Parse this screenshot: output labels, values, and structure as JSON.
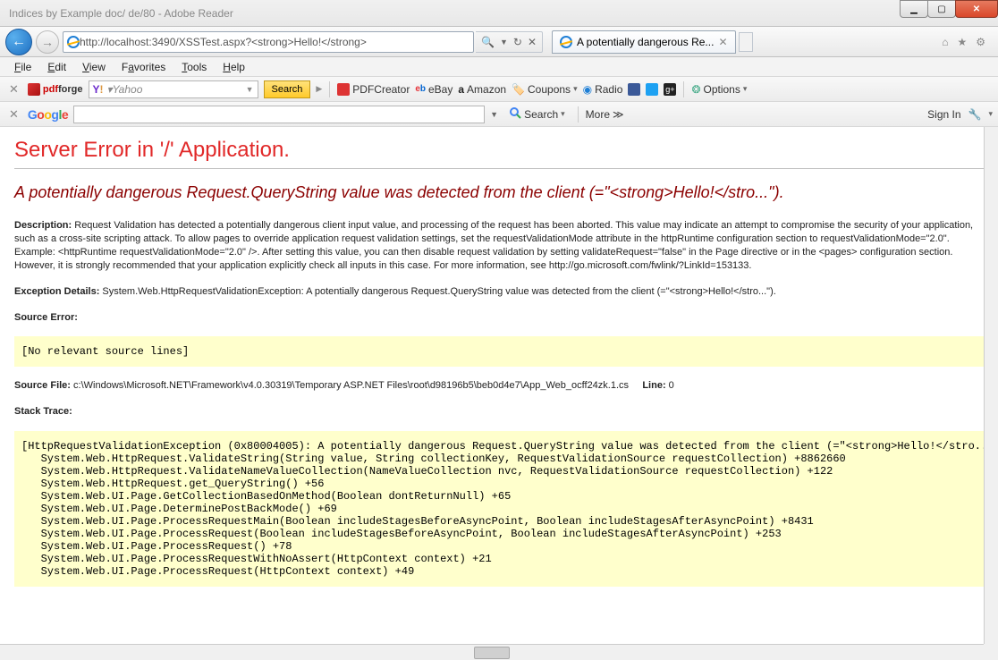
{
  "window": {
    "background_title": "Indices by Example doc/ de/80 - Adobe Reader"
  },
  "nav": {
    "url": "http://localhost:3490/XSSTest.aspx?<strong>Hello!</strong>",
    "tab_title": "A potentially dangerous Re..."
  },
  "menu": {
    "file": "File",
    "edit": "Edit",
    "view": "View",
    "favorites": "Favorites",
    "tools": "Tools",
    "help": "Help"
  },
  "toolbar1": {
    "pdfforge": "pdfforge",
    "yahoo_placeholder": "Yahoo",
    "search_btn": "Search",
    "pdfcreator": "PDFCreator",
    "ebay": "eBay",
    "amazon": "Amazon",
    "coupons": "Coupons",
    "radio": "Radio",
    "options": "Options"
  },
  "toolbar2": {
    "search_label": "Search",
    "more_label": "More",
    "signin": "Sign In"
  },
  "error": {
    "h1": "Server Error in '/' Application.",
    "h2": "A potentially dangerous Request.QueryString value was detected from the client (=\"<strong>Hello!</stro...\").",
    "description_label": "Description:",
    "description_text": "Request Validation has detected a potentially dangerous client input value, and processing of the request has been aborted. This value may indicate an attempt to compromise the security of your application, such as a cross-site scripting attack. To allow pages to override application request validation settings, set the requestValidationMode attribute in the httpRuntime configuration section to requestValidationMode=\"2.0\". Example: <httpRuntime requestValidationMode=\"2.0\" />. After setting this value, you can then disable request validation by setting validateRequest=\"false\" in the Page directive or in the <pages> configuration section. However, it is strongly recommended that your application explicitly check all inputs in this case. For more information, see http://go.microsoft.com/fwlink/?LinkId=153133.",
    "exception_label": "Exception Details:",
    "exception_text": "System.Web.HttpRequestValidationException: A potentially dangerous Request.QueryString value was detected from the client (=\"<strong>Hello!</stro...\").",
    "source_error_label": "Source Error:",
    "source_error_code": "[No relevant source lines]",
    "source_file_label": "Source File:",
    "source_file_text": "c:\\Windows\\Microsoft.NET\\Framework\\v4.0.30319\\Temporary ASP.NET Files\\root\\d98196b5\\beb0d4e7\\App_Web_ocff24zk.1.cs",
    "line_label": "Line:",
    "line_value": "0",
    "stack_trace_label": "Stack Trace:",
    "stack_trace_code": "[HttpRequestValidationException (0x80004005): A potentially dangerous Request.QueryString value was detected from the client (=\"<strong>Hello!</stro...\"\n   System.Web.HttpRequest.ValidateString(String value, String collectionKey, RequestValidationSource requestCollection) +8862660\n   System.Web.HttpRequest.ValidateNameValueCollection(NameValueCollection nvc, RequestValidationSource requestCollection) +122\n   System.Web.HttpRequest.get_QueryString() +56\n   System.Web.UI.Page.GetCollectionBasedOnMethod(Boolean dontReturnNull) +65\n   System.Web.UI.Page.DeterminePostBackMode() +69\n   System.Web.UI.Page.ProcessRequestMain(Boolean includeStagesBeforeAsyncPoint, Boolean includeStagesAfterAsyncPoint) +8431\n   System.Web.UI.Page.ProcessRequest(Boolean includeStagesBeforeAsyncPoint, Boolean includeStagesAfterAsyncPoint) +253\n   System.Web.UI.Page.ProcessRequest() +78\n   System.Web.UI.Page.ProcessRequestWithNoAssert(HttpContext context) +21\n   System.Web.UI.Page.ProcessRequest(HttpContext context) +49"
  }
}
